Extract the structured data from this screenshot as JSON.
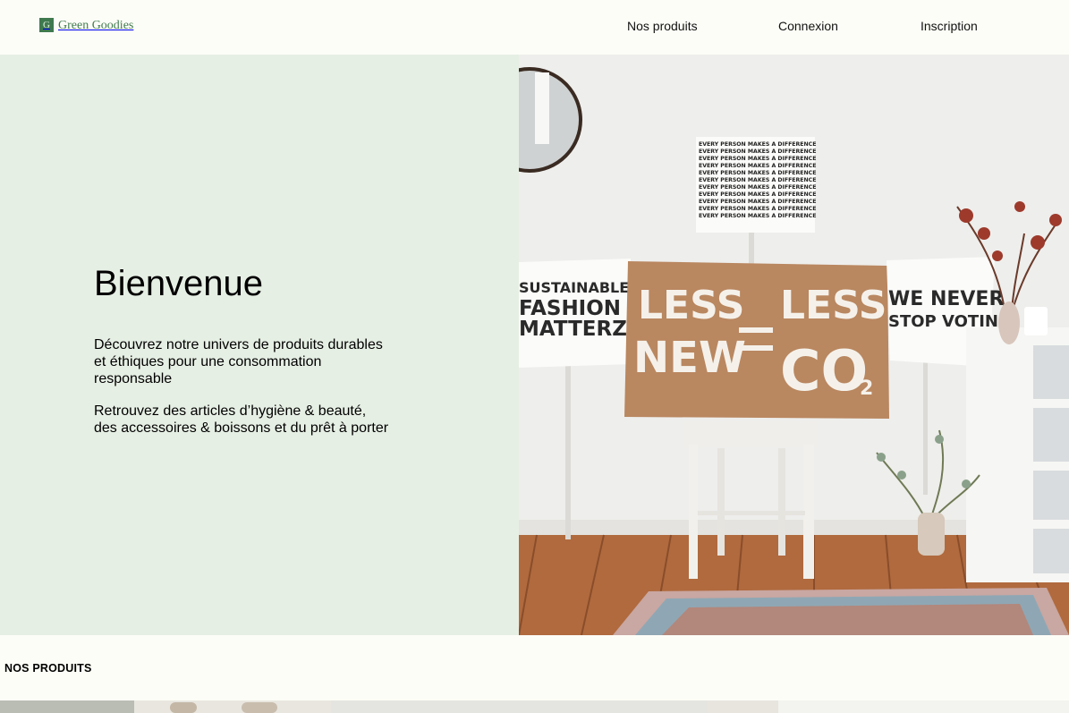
{
  "header": {
    "logo_letter": "G",
    "logo_text": "Green Goodies",
    "nav": [
      "Nos produits",
      "Connexion",
      "Inscription"
    ]
  },
  "hero": {
    "title": "Bienvenue",
    "paragraphs": [
      "Découvrez notre univers de produits durables et éthiques pour une consommation responsable",
      "Retrouvez des articles d’hygiène & beauté, des accessoires & boissons et du prêt à porter"
    ],
    "image": {
      "top_sign_line": "EVERY PERSON MAKES A DIFFERENCE",
      "left_sign": [
        "SUSTAINABLE",
        "FASHION",
        "MATTERZ"
      ],
      "center_sign": {
        "left_top": "LESS",
        "left_bottom": "NEW",
        "right_top": "LESS",
        "right_bottom": "CO",
        "subscript": "2"
      },
      "right_sign": [
        "WE NEVER",
        "STOP VOTING"
      ]
    }
  },
  "products_section": {
    "title": "NOS PRODUITS"
  },
  "colors": {
    "brand_green": "#3f7a4f",
    "hero_bg": "#e6efe4",
    "page_bg": "#fdfdf7"
  }
}
